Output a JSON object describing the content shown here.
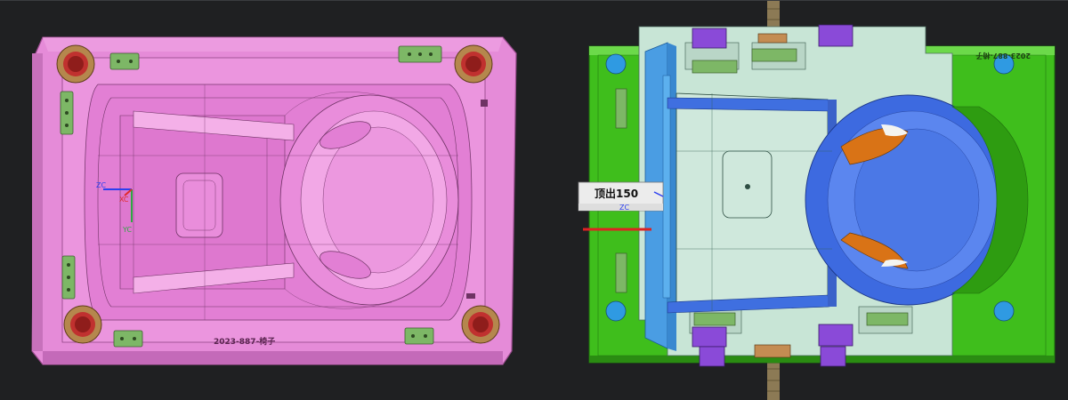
{
  "left_view": {
    "engraving_label": "2023-887-椅子",
    "axis_labels": {
      "x": "XC",
      "y": "YC",
      "z": "ZC"
    }
  },
  "right_view": {
    "engraving_label": "2023-887-椅子",
    "ejection_callout": "顶出150",
    "axis_labels": {
      "z": "ZC"
    }
  },
  "colors": {
    "background": "#1f2022",
    "cavity_plate": "#e887d9",
    "core_plate": "#46c41e",
    "insert_block": "#c6e2d4",
    "product_chair": "#3f6fe0",
    "slider_block": "#4f9de0",
    "ejector_block": "#8844dd"
  }
}
